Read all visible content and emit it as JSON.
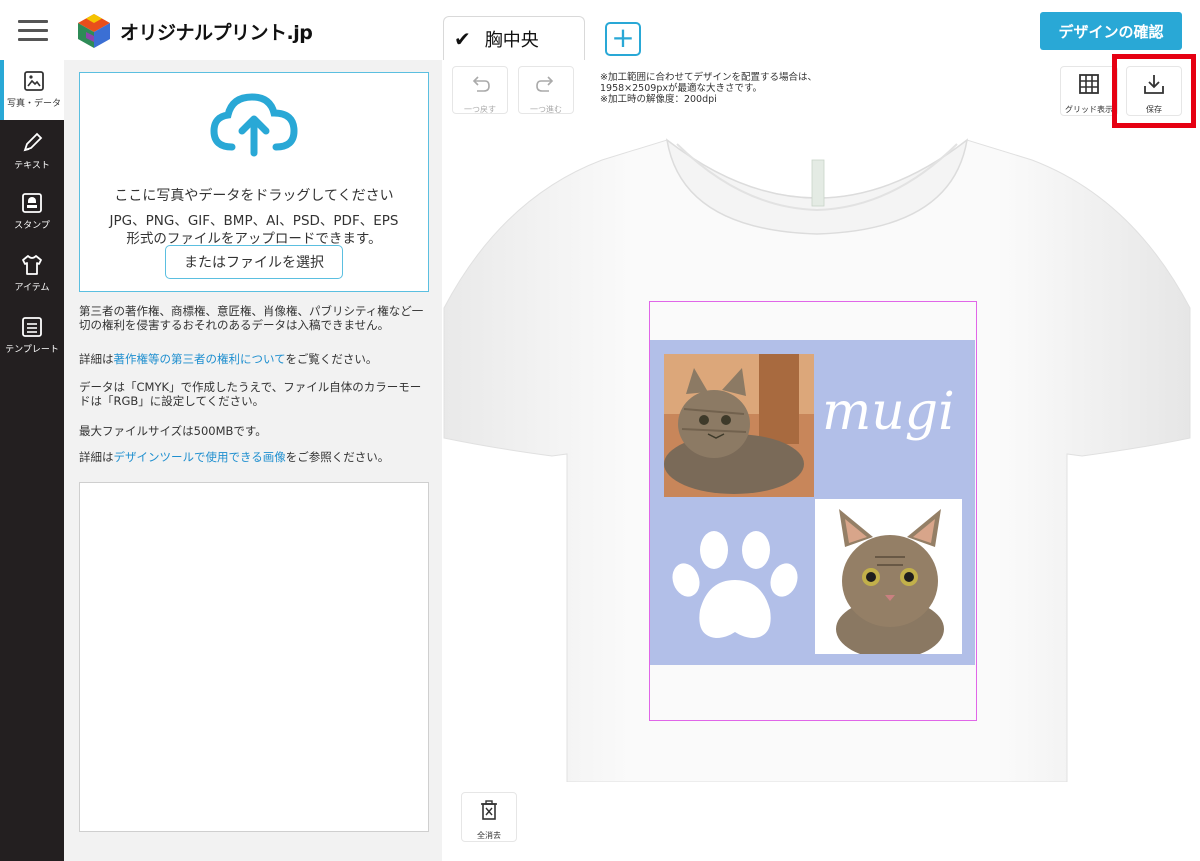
{
  "header": {
    "logo_text": "オリジナルプリント.jp",
    "confirm_label": "デザインの確認"
  },
  "tabs": [
    {
      "label": "胸中央",
      "checked": true
    }
  ],
  "add_tab_label": "+",
  "sidebar": {
    "items": [
      {
        "label": "写真・データ",
        "icon": "image-icon",
        "active": true
      },
      {
        "label": "テキスト",
        "icon": "pen-icon"
      },
      {
        "label": "スタンプ",
        "icon": "stamp-icon"
      },
      {
        "label": "アイテム",
        "icon": "tshirt-icon"
      },
      {
        "label": "テンプレート",
        "icon": "template-icon"
      }
    ]
  },
  "upload": {
    "line1": "ここに写真やデータをドラッグしてください",
    "line2": "JPG、PNG、GIF、BMP、AI、PSD、PDF、EPS",
    "line3": "形式のファイルをアップロードできます。",
    "select_label": "またはファイルを選択"
  },
  "notes": {
    "rights": "第三者の著作権、商標権、意匠権、肖像権、パブリシティ権など一切の権利を侵害するおそれのあるデータは入稿できません。",
    "rights_prefix": "詳細は",
    "rights_link": "著作権等の第三者の権利について",
    "rights_suffix": "をご覧ください。",
    "cmyk": "データは「CMYK」で作成したうえで、ファイル自体のカラーモードは「RGB」に設定してください。",
    "max_size": "最大ファイルサイズは500MBです。",
    "images_prefix": "詳細は",
    "images_link": "デザインツールで使用できる画像",
    "images_suffix": "をご参照ください。"
  },
  "toolbar": {
    "undo_label": "一つ戻す",
    "redo_label": "一つ進む",
    "grid_label": "グリッド表示",
    "save_label": "保存",
    "clear_label": "全消去"
  },
  "notice": {
    "line1": "※加工範囲に合わせてデザインを配置する場合は、",
    "line2": "1958×2509pxが最適な大きさです。",
    "line3": "※加工時の解像度：200dpi"
  },
  "design": {
    "text": "mugi",
    "bg_color": "#b2bfe8"
  },
  "colors": {
    "accent": "#29a8d6",
    "highlight": "#e60012",
    "rail": "#231f20"
  }
}
